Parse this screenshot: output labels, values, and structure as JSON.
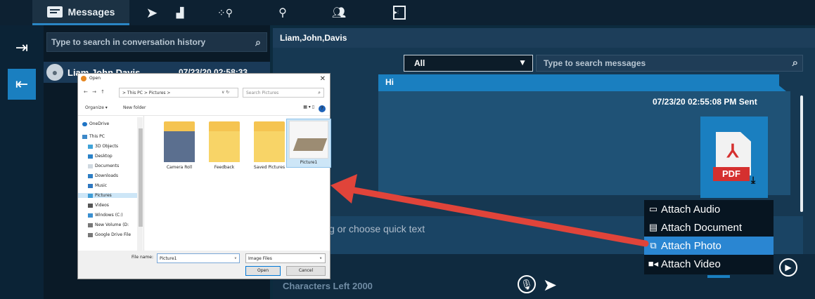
{
  "toolbar": {
    "messages_tab": "Messages",
    "tabs": [
      "messages",
      "send-location",
      "geofence",
      "person-location",
      "group",
      "media"
    ]
  },
  "conversations": {
    "search_placeholder": "Type to search in conversation history",
    "items": [
      {
        "name": "Liam,John,Davis",
        "time": "07/23/20 02:58:33 ..."
      }
    ]
  },
  "chat": {
    "title": "Liam,John,Davis",
    "filter_value": "All",
    "search_placeholder": "Type to search messages",
    "messages": [
      {
        "text": "Hi"
      },
      {
        "meta": "07/23/20 02:55:08 PM Sent",
        "attachment_label": "PDF"
      }
    ],
    "compose_placeholder": "g or choose quick text",
    "chars_left": "Characters Left 2000"
  },
  "attach_menu": {
    "items": [
      {
        "label": "Attach Audio",
        "icon": "voicemail-icon"
      },
      {
        "label": "Attach Document",
        "icon": "document-icon"
      },
      {
        "label": "Attach Photo",
        "icon": "photo-icon"
      },
      {
        "label": "Attach Video",
        "icon": "video-icon"
      }
    ],
    "selected": "Attach Photo"
  },
  "dialog": {
    "title": "Open",
    "path": "> This PC > Pictures >",
    "search_placeholder": "Search Pictures",
    "organize": "Organize ▾",
    "new_folder": "New folder",
    "tree": [
      "OneDrive",
      "This PC",
      "3D Objects",
      "Desktop",
      "Documents",
      "Downloads",
      "Music",
      "Pictures",
      "Videos",
      "Windows (C:)",
      "New Volume (D:",
      "Google Drive File"
    ],
    "tree_selected": "Pictures",
    "files": [
      "Camera Roll",
      "Feedback",
      "Saved Pictures",
      "Picture1"
    ],
    "selected_file": "Picture1",
    "filename_label": "File name:",
    "filename_value": "Picture1",
    "filter": "Image Files",
    "open_label": "Open",
    "cancel_label": "Cancel"
  },
  "colors": {
    "accent": "#1a7fc0",
    "background": "#0c2b3e",
    "annotation_arrow": "#e0443a"
  }
}
